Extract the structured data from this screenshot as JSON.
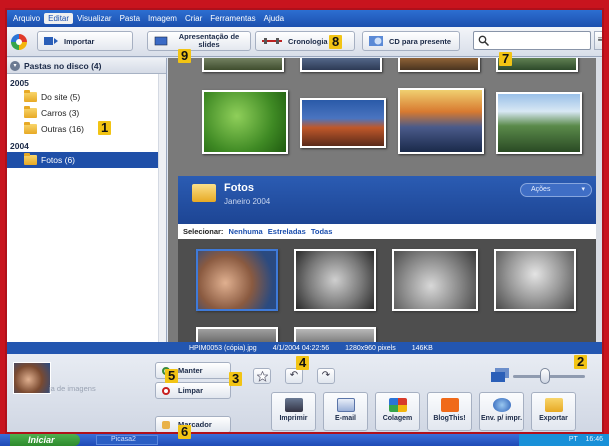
{
  "menu": [
    "Arquivo",
    "Editar",
    "Visualizar",
    "Pasta",
    "Imagem",
    "Criar",
    "Ferramentas",
    "Ajuda"
  ],
  "toolbar": {
    "importar": "Importar",
    "apresentacao": "Apresentação de slides",
    "cronologia": "Cronologia",
    "cd": "CD para presente",
    "menu_icon": "≡"
  },
  "left_panel": {
    "header": "Pastas no disco (4)",
    "collapse_glyph": "▾",
    "years": [
      {
        "label": "2005",
        "folders": [
          "Do site (5)",
          "Carros (3)",
          "Outras (16)"
        ]
      },
      {
        "label": "2004",
        "folders": [
          "Fotos (6)"
        ]
      }
    ]
  },
  "album": {
    "title": "Fotos",
    "date": "Janeiro 2004",
    "acoes": "Ações",
    "select_label": "Selecionar:",
    "select_links": [
      "Nenhuma",
      "Estreladas",
      "Todas"
    ]
  },
  "statusbar": {
    "filename": "HPIM0053 (cópia).jpg",
    "datetime": "4/1/2004 04:22:56",
    "dimensions": "1280x960 pixels",
    "size": "146KB"
  },
  "bottom": {
    "tray_label": "ja de imagens",
    "manter": "Manter",
    "limpar": "Limpar",
    "marcador": "Marcador",
    "rotate_left": "↶",
    "rotate_right": "↷",
    "zoom_level": 0.44,
    "actions": [
      "Imprimir",
      "E-mail",
      "Colagem",
      "BlogThis!",
      "Env. p/ impr.",
      "Exportar"
    ]
  },
  "taskbar": {
    "start": "Iniciar",
    "task": "Picasa2",
    "tray_text": "PT",
    "clock": "16:46"
  },
  "callouts": [
    "1",
    "2",
    "3",
    "4",
    "5",
    "6",
    "7",
    "8",
    "9"
  ],
  "colors": {
    "accent_blue": "#1f4fa8",
    "callout_yellow": "#f2c414",
    "frame_red": "#b0101a"
  }
}
